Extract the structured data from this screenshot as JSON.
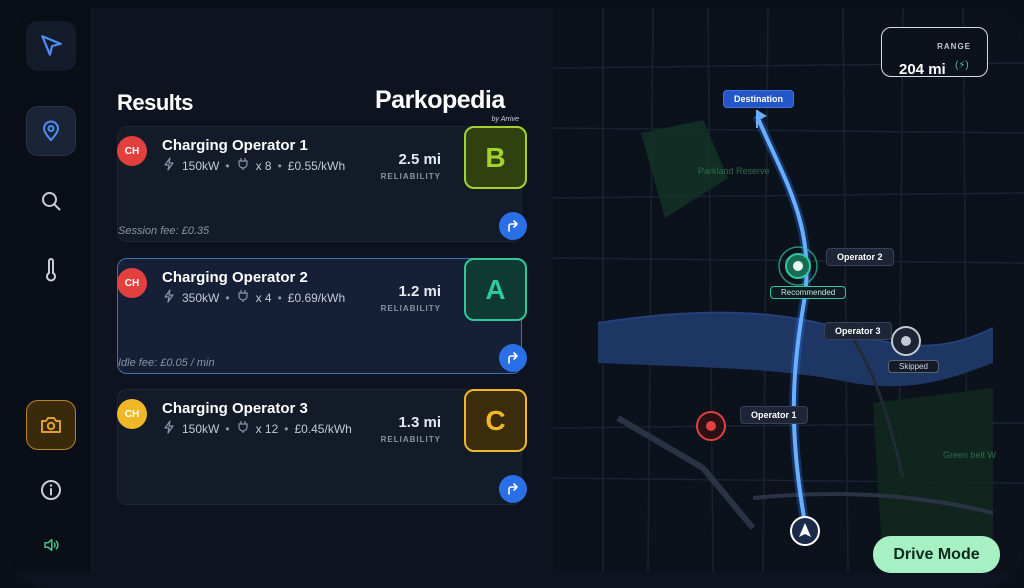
{
  "results": {
    "title": "Results",
    "brand": {
      "name": "Parkopedia",
      "sub": "by Arrive"
    },
    "cards": [
      {
        "badge": "CH",
        "badge_color": "#e23f3f",
        "name": "Charging Operator 1",
        "power": "150kW",
        "sep1": "•",
        "plugs": "x 8",
        "sep2": "•",
        "price": "£0.55/kWh",
        "distance": "2.5 mi",
        "reliability_label": "RELIABILITY",
        "grade": "B",
        "grade_bg": "#31400f",
        "grade_border": "#a3d22f",
        "grade_color": "#a3d22f",
        "fee": "Session fee: £0.35"
      },
      {
        "badge": "CH",
        "badge_color": "#e23f3f",
        "name": "Charging Operator 2",
        "power": "350kW",
        "sep1": "•",
        "plugs": "x 4",
        "sep2": "•",
        "price": "£0.69/kWh",
        "distance": "1.2 mi",
        "reliability_label": "RELIABILITY",
        "grade": "A",
        "grade_bg": "#0e3a33",
        "grade_border": "#2fc79b",
        "grade_color": "#2fc79b",
        "fee": "Idle fee: £0.05 / min"
      },
      {
        "badge": "CH",
        "badge_color": "#f0b829",
        "name": "Charging Operator 3",
        "power": "150kW",
        "sep1": "•",
        "plugs": "x 12",
        "sep2": "•",
        "price": "£0.45/kWh",
        "distance": "1.3 mi",
        "reliability_label": "RELIABILITY",
        "grade": "C",
        "grade_bg": "#3a2c0d",
        "grade_border": "#f0b829",
        "grade_color": "#f0b829",
        "fee": ""
      }
    ]
  },
  "map": {
    "range_label": "RANGE",
    "range_value": "204 mi",
    "range_icon": "(⚡)",
    "destination": "Destination",
    "operator1": "Operator 1",
    "operator2": "Operator 2",
    "operator3": "Operator 3",
    "recommended": "Recommended",
    "skipped": "Skipped",
    "park1": "Parkland Reserve",
    "park2": "Green belt W"
  },
  "drive_mode": "Drive Mode",
  "colors": {
    "accent": "#2a6fe6",
    "route": "#5aa3ff",
    "recommended": "#2fc79b",
    "camera": "#e0a030"
  }
}
